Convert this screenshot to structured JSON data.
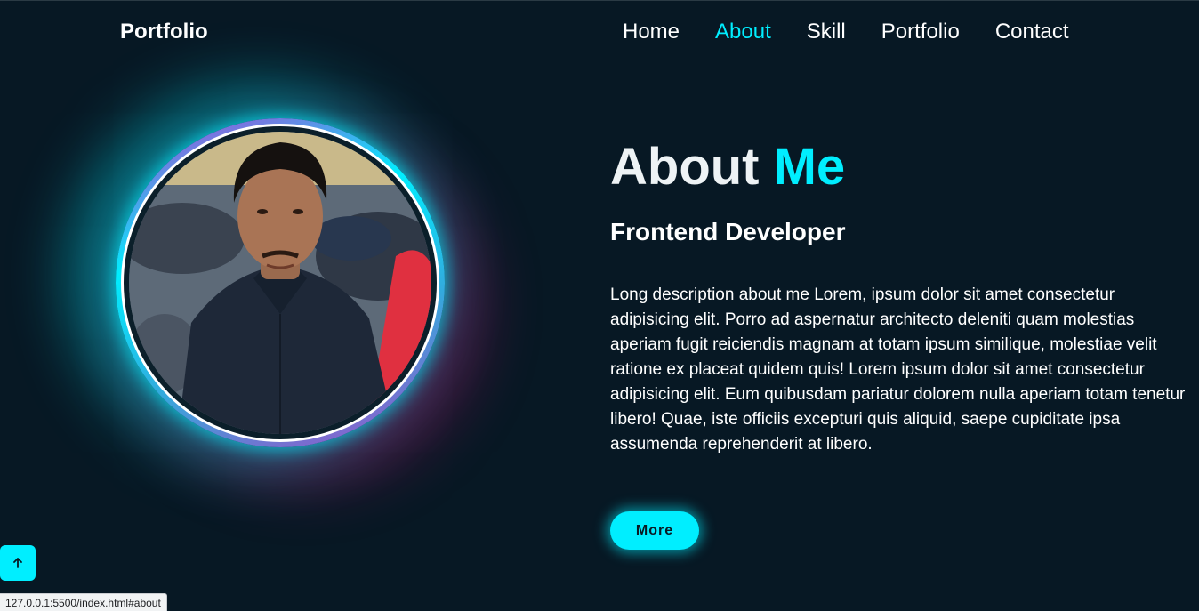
{
  "header": {
    "logo": "Portfolio",
    "nav": [
      {
        "label": "Home",
        "active": false
      },
      {
        "label": "About",
        "active": true
      },
      {
        "label": "Skill",
        "active": false
      },
      {
        "label": "Portfolio",
        "active": false
      },
      {
        "label": "Contact",
        "active": false
      }
    ]
  },
  "about": {
    "title_main": "About ",
    "title_accent": "Me",
    "subtitle": "Frontend Developer",
    "description": "Long description about me Lorem, ipsum dolor sit amet consectetur adipisicing elit. Porro ad aspernatur architecto deleniti quam molestias aperiam fugit reiciendis magnam at totam ipsum similique, molestiae velit ratione ex placeat quidem quis! Lorem ipsum dolor sit amet consectetur adipisicing elit. Eum quibusdam pariatur dolorem nulla aperiam totam tenetur libero! Quae, iste officiis excepturi quis aliquid, saepe cupiditate ipsa assumenda reprehenderit at libero.",
    "button_label": "More"
  },
  "scroll_top_icon": "arrow-up-icon",
  "status_url": "127.0.0.1:5500/index.html#about",
  "colors": {
    "background": "#071824",
    "accent": "#00eeff",
    "text": "#ffffff"
  }
}
